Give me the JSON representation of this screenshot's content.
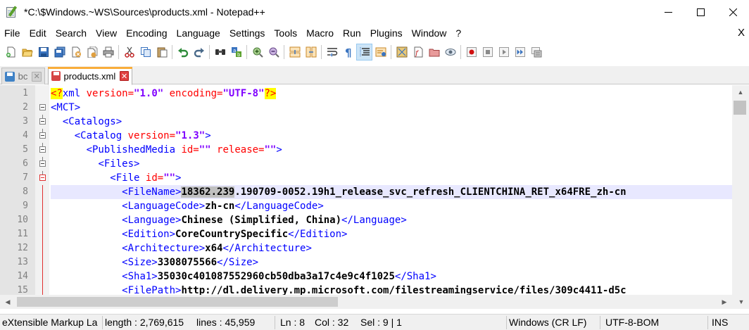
{
  "window": {
    "title": "*C:\\$Windows.~WS\\Sources\\products.xml - Notepad++",
    "minimize_icon": "minimize-icon",
    "maximize_icon": "maximize-icon",
    "close_icon": "close-icon"
  },
  "menu": {
    "items": [
      "File",
      "Edit",
      "Search",
      "View",
      "Encoding",
      "Language",
      "Settings",
      "Tools",
      "Macro",
      "Run",
      "Plugins",
      "Window",
      "?"
    ],
    "close_label": "X"
  },
  "tabs": [
    {
      "label": "bc",
      "state": "saved",
      "active": false
    },
    {
      "label": "products.xml",
      "state": "unsaved",
      "active": true
    }
  ],
  "editor": {
    "lines": [
      {
        "n": "1"
      },
      {
        "n": "2"
      },
      {
        "n": "3"
      },
      {
        "n": "4"
      },
      {
        "n": "5"
      },
      {
        "n": "6"
      },
      {
        "n": "7"
      },
      {
        "n": "8"
      },
      {
        "n": "9"
      },
      {
        "n": "10"
      },
      {
        "n": "11"
      },
      {
        "n": "12"
      },
      {
        "n": "13"
      },
      {
        "n": "14"
      },
      {
        "n": "15"
      }
    ],
    "xml": {
      "decl_open": "<?",
      "decl_name": "xml",
      "decl_attr1": "version=",
      "decl_val1": "\"1.0\"",
      "decl_attr2": "encoding=",
      "decl_val2": "\"UTF-8\"",
      "decl_close": "?>",
      "mct": "<MCT>",
      "catalogs": "<Catalogs>",
      "catalog_open": "<Catalog",
      "catalog_attr": "version=",
      "catalog_val": "\"1.3\"",
      "catalog_close": ">",
      "pm_open": "<PublishedMedia",
      "pm_attr1": "id=",
      "pm_val1": "\"\"",
      "pm_attr2": "release=",
      "pm_val2": "\"\"",
      "pm_close": ">",
      "files": "<Files>",
      "file_open": "<File",
      "file_attr": "id=",
      "file_val": "\"\"",
      "file_close": ">",
      "filename_open": "<FileName>",
      "filename_sel": "18362.239",
      "filename_rest": ".190709-0052.19h1_release_svc_refresh_CLIENTCHINA_RET_x64FRE_zh-cn",
      "lc_open": "<LanguageCode>",
      "lc_val": "zh-cn",
      "lc_close": "</LanguageCode>",
      "lang_open": "<Language>",
      "lang_val": "Chinese (Simplified, China)",
      "lang_close": "</Language>",
      "ed_open": "<Edition>",
      "ed_val": "CoreCountrySpecific",
      "ed_close": "</Edition>",
      "arch_open": "<Architecture>",
      "arch_val": "x64",
      "arch_close": "</Architecture>",
      "size_open": "<Size>",
      "size_val": "3308075566",
      "size_close": "</Size>",
      "sha_open": "<Sha1>",
      "sha_val": "35030c401087552960cb50dba3a17c4e9c4f1025",
      "sha_close": "</Sha1>",
      "fp_open": "<FilePath>",
      "fp_val": "http://dl.delivery.mp.microsoft.com/filestreamingservice/files/309c4411-d5c"
    }
  },
  "status": {
    "file_type": "eXtensible Markup La",
    "length": "length : 2,769,615",
    "lines": "lines : 45,959",
    "ln": "Ln : 8",
    "col": "Col : 32",
    "sel": "Sel : 9 | 1",
    "eol": "Windows (CR LF)",
    "encoding": "UTF-8-BOM",
    "mode": "INS"
  },
  "toolbar_icons": [
    "new-file-icon",
    "open-file-icon",
    "save-icon",
    "save-all-icon",
    "close-icon",
    "close-all-icon",
    "print-icon",
    "cut-icon",
    "copy-icon",
    "paste-icon",
    "undo-icon",
    "redo-icon",
    "find-icon",
    "replace-icon",
    "zoom-in-icon",
    "zoom-out-icon",
    "sync-vertical-icon",
    "sync-horizontal-icon",
    "word-wrap-icon",
    "show-all-characters-icon",
    "indent-guide-icon",
    "user-defined-language-icon",
    "document-map-icon",
    "function-list-icon",
    "folder-as-workspace-icon",
    "monitoring-icon",
    "record-macro-icon",
    "stop-macro-icon",
    "play-macro-icon",
    "run-macro-multiple-icon",
    "save-macro-icon"
  ]
}
